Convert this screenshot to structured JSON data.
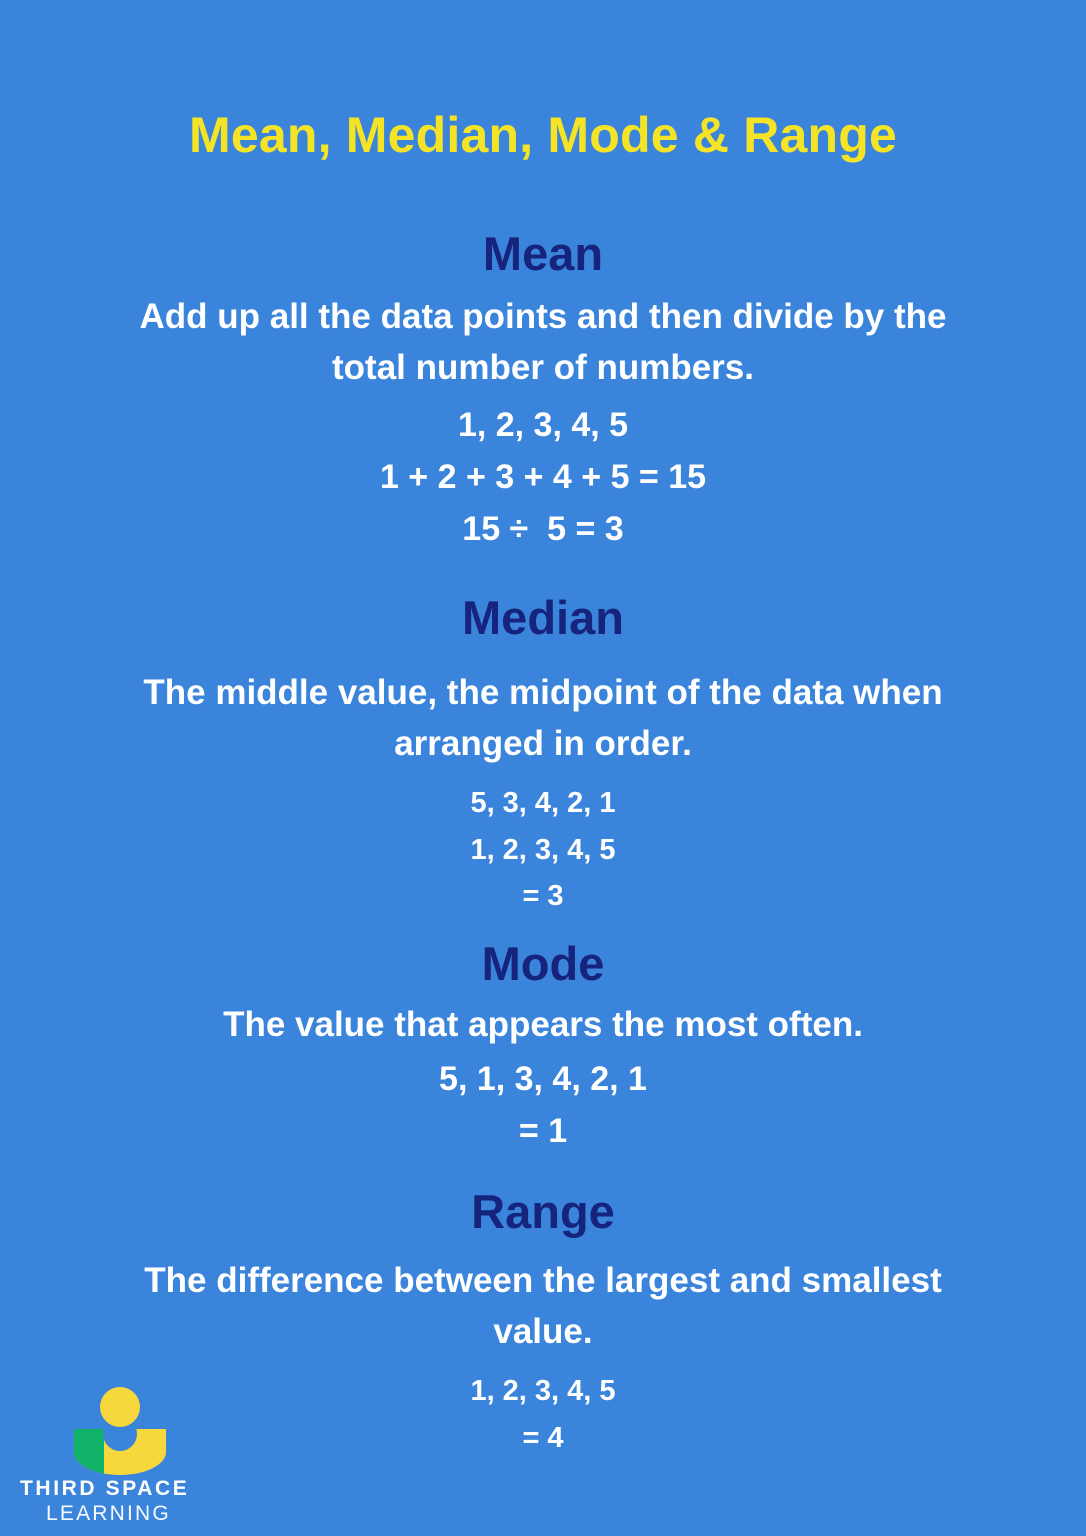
{
  "colors": {
    "background": "#3a85db",
    "title_yellow": "#f5e426",
    "heading_navy": "#16247e",
    "body_white": "#ffffff",
    "logo_yellow": "#f7d83c",
    "logo_green": "#10b268"
  },
  "title": "Mean, Median, Mode & Range",
  "sections": [
    {
      "heading": "Mean",
      "description": "Add up all the data points and then divide by the total number of numbers.",
      "examples": [
        "1, 2, 3, 4, 5",
        "1 + 2 + 3 + 4 + 5 = 15",
        "15 ÷  5 = 3"
      ]
    },
    {
      "heading": "Median",
      "description": "The middle value, the midpoint of the data when arranged in order.",
      "examples": [
        "5, 3, 4, 2, 1",
        "1, 2, 3, 4, 5",
        "= 3"
      ]
    },
    {
      "heading": "Mode",
      "description": "The value that appears the most often.",
      "examples": [
        "5, 1, 3, 4, 2, 1",
        "= 1"
      ]
    },
    {
      "heading": "Range",
      "description": "The difference between the largest and smallest value.",
      "examples": [
        "1, 2, 3, 4, 5",
        "= 4"
      ]
    }
  ],
  "logo": {
    "name_top": "THIRD SPACE",
    "name_bottom": "LEARNING"
  }
}
